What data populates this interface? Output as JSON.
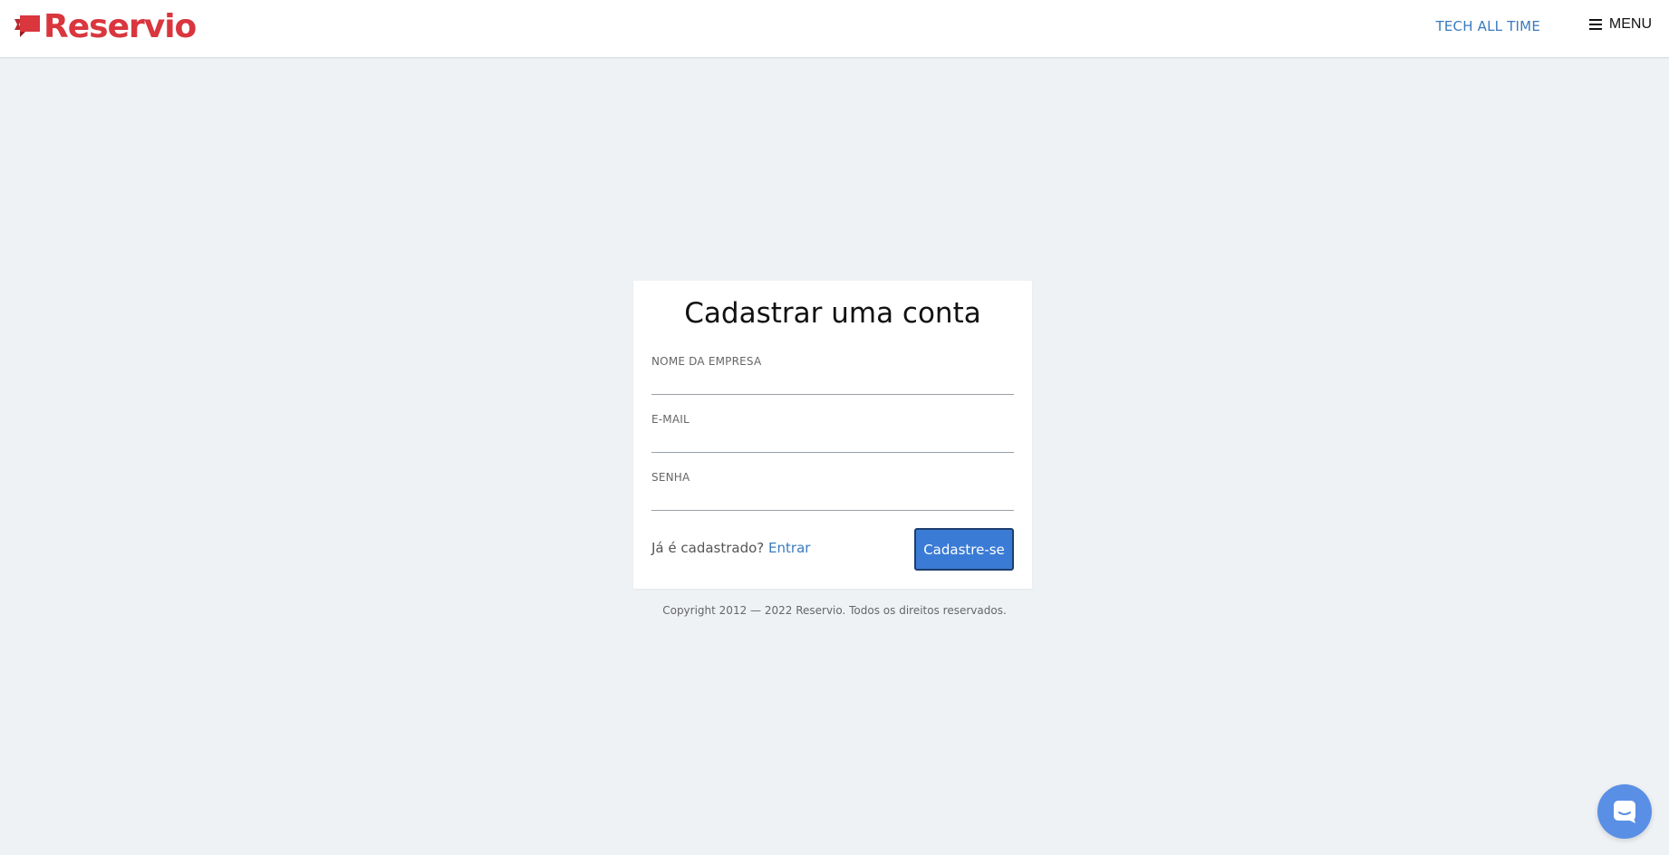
{
  "header": {
    "logo_text": "Reservio",
    "company_name": "TECH ALL TIME",
    "menu_label": "MENU"
  },
  "form": {
    "title": "Cadastrar uma conta",
    "fields": [
      {
        "label": "NOME DA EMPRESA",
        "value": ""
      },
      {
        "label": "E-MAIL",
        "value": ""
      },
      {
        "label": "SENHA",
        "value": ""
      }
    ],
    "login_prompt": "Já é cadastrado?",
    "login_link": "Entrar",
    "submit_label": "Cadastre-se"
  },
  "footer": {
    "copyright": "Copyright 2012 — 2022 Reservio. Todos os direitos reservados."
  },
  "icons": {
    "logo": "reservio-flag-icon",
    "menu": "hamburger-menu-icon",
    "chat": "chat-bubble-icon"
  },
  "colors": {
    "brand": "#d9363e",
    "accent": "#3a7bd5",
    "link": "#3a7bbf",
    "background": "#eff2f5"
  }
}
